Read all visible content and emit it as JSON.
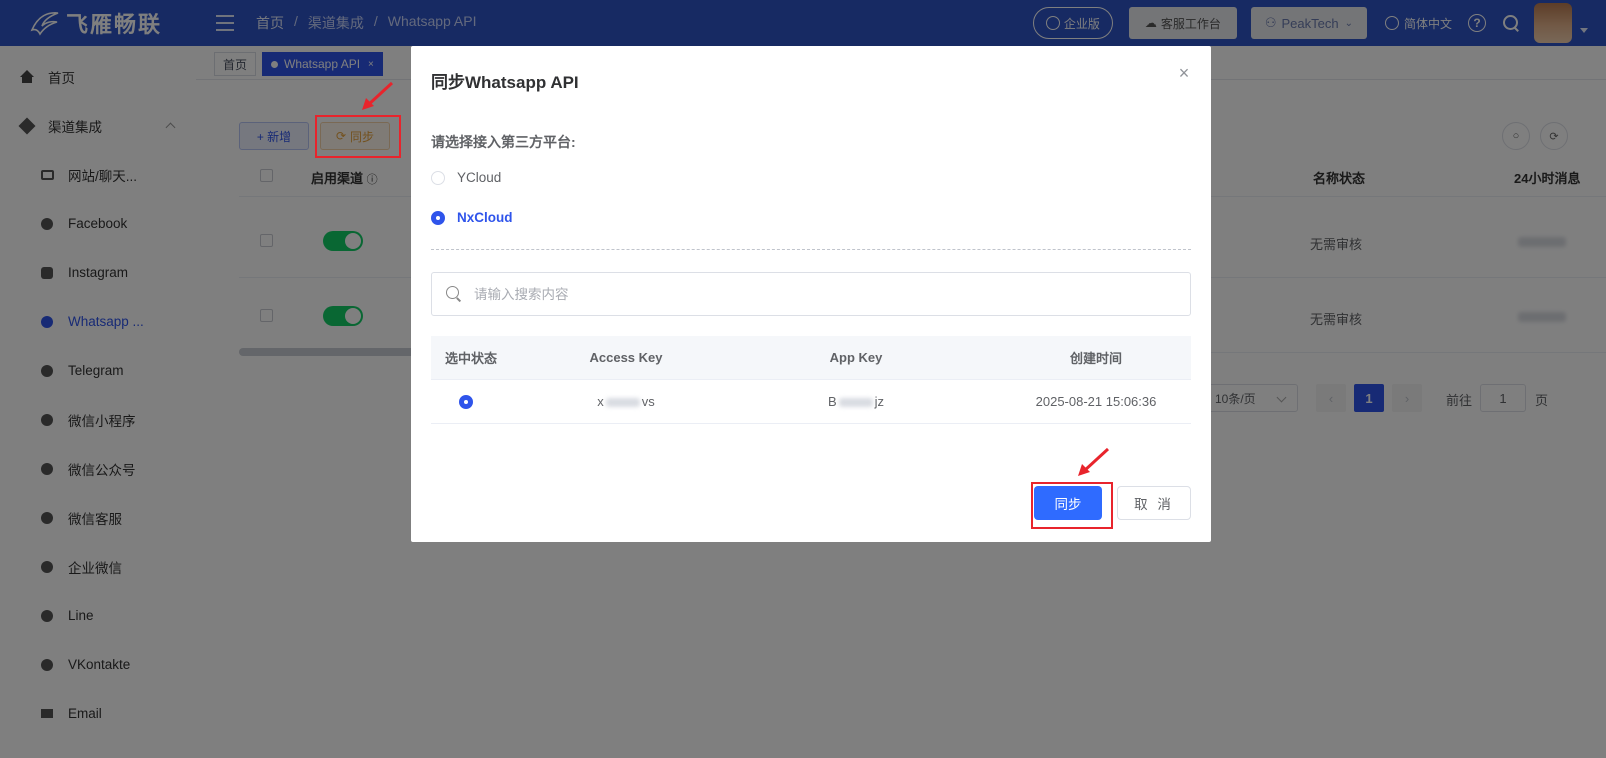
{
  "header": {
    "brand": "飞雁畅联",
    "breadcrumbs": [
      "首页",
      "渠道集成",
      "Whatsapp API"
    ],
    "enterprise_badge": "企业版",
    "workbench_button": "客服工作台",
    "org_name": "PeakTech",
    "language": "简体中文"
  },
  "sidebar": {
    "items": [
      {
        "label": "首页"
      },
      {
        "label": "渠道集成"
      },
      {
        "label": "网站/聊天..."
      },
      {
        "label": "Facebook"
      },
      {
        "label": "Instagram"
      },
      {
        "label": "Whatsapp ..."
      },
      {
        "label": "Telegram"
      },
      {
        "label": "微信小程序"
      },
      {
        "label": "微信公众号"
      },
      {
        "label": "微信客服"
      },
      {
        "label": "企业微信"
      },
      {
        "label": "Line"
      },
      {
        "label": "VKontakte"
      },
      {
        "label": "Email"
      }
    ]
  },
  "tabs": [
    {
      "label": "首页"
    },
    {
      "label": "Whatsapp API",
      "close": "×"
    }
  ],
  "main": {
    "add_button": "+ 新增",
    "sync_button": "同步",
    "columns": {
      "enable": "启用渠道",
      "name_status": "名称状态",
      "msg_24h": "24小时消息"
    },
    "rows": [
      {
        "status": "无需审核"
      },
      {
        "status": "无需审核"
      }
    ],
    "pager": {
      "page_size": "10条/页",
      "prev": "‹",
      "current": "1",
      "next": "›",
      "goto_label": "前往",
      "goto_value": "1",
      "page_suffix": "页"
    }
  },
  "modal": {
    "title": "同步Whatsapp API",
    "close": "×",
    "prompt": "请选择接入第三方平台:",
    "options": [
      {
        "label": "YCloud",
        "selected": false
      },
      {
        "label": "NxCloud",
        "selected": true
      }
    ],
    "search_placeholder": "请输入搜索内容",
    "table": {
      "headers": [
        "选中状态",
        "Access Key",
        "App Key",
        "创建时间"
      ],
      "rows": [
        {
          "access_key_start": "x",
          "access_key_end": "vs",
          "app_key_start": "B",
          "app_key_end": "jz",
          "created": "2025-08-21 15:06:36"
        }
      ]
    },
    "confirm_button": "同步",
    "cancel_button": "取 消"
  },
  "colors": {
    "header_bg": "#2f54c6",
    "primary": "#2f6bff",
    "highlight": "#e8242c",
    "toggle_on": "#13ce66"
  }
}
